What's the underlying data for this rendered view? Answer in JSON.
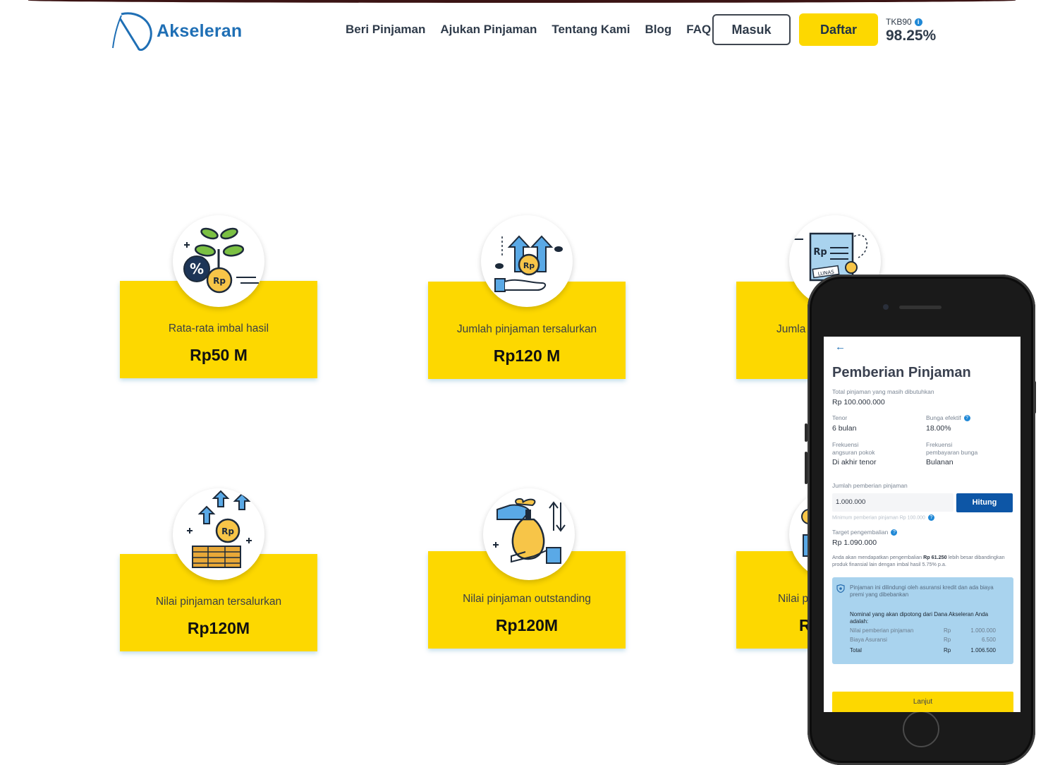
{
  "header": {
    "logo_text": "Akseleran",
    "nav": [
      "Beri Pinjaman",
      "Ajukan Pinjaman",
      "Tentang Kami",
      "Blog",
      "FAQ"
    ],
    "login_label": "Masuk",
    "register_label": "Daftar",
    "tkb_label": "TKB90",
    "tkb_value": "98.25%"
  },
  "stats": [
    {
      "label": "Rata-rata imbal hasil",
      "value": "Rp50 M",
      "icon": "plant-percent-icon"
    },
    {
      "label": "Jumlah pinjaman tersalurkan",
      "value": "Rp120 M",
      "icon": "hand-money-growth-icon"
    },
    {
      "label": "Jumla",
      "value": "",
      "icon": "invoice-lunas-icon"
    },
    {
      "label": "Nilai pinjaman tersalurkan",
      "value": "Rp120M",
      "icon": "coin-stack-growth-icon"
    },
    {
      "label": "Nilai pinjaman outstanding",
      "value": "Rp120M",
      "icon": "money-bag-exchange-icon"
    },
    {
      "label": "Nilai p",
      "value": "R",
      "icon": "partial-icon"
    }
  ],
  "phone": {
    "back_icon": "arrow-left-icon",
    "title": "Pemberian Pinjaman",
    "total_label": "Total pinjaman yang masih dibutuhkan",
    "total_value": "Rp 100.000.000",
    "tenor_label": "Tenor",
    "tenor_value": "6 bulan",
    "bunga_label": "Bunga efektif",
    "bunga_value": "18.00%",
    "freq_pokok_label_1": "Frekuensi",
    "freq_pokok_label_2": "angsuran pokok",
    "freq_pokok_value": "Di akhir tenor",
    "freq_bunga_label_1": "Frekuensi",
    "freq_bunga_label_2": "pembayaran bunga",
    "freq_bunga_value": "Bulanan",
    "jumlah_label": "Jumlah pemberian pinjaman",
    "jumlah_value": "1.000.000",
    "hitung_label": "Hitung",
    "minimum_note": "Minimum pemberian pinjaman Rp 100.000",
    "target_label": "Target pengembalian",
    "target_value": "Rp 1.090.000",
    "note_a": "Anda akan mendapatkan pengembalian ",
    "note_b": "Rp 61.250",
    "note_c": " lebih besar dibandingkan produk finansial lain dengan imbal hasil 5.75% p.a.",
    "insurance_text": "Pinjaman ini dilindungi oleh asuransi kredit dan ada biaya premi yang dibebankan",
    "deduct_text": "Nominal yang akan dipotong dari Dana Akseleran Anda adalah:",
    "rows": [
      {
        "label": "Nilai pemberian pinjaman",
        "rp": "Rp",
        "amount": "1.000.000"
      },
      {
        "label": "Biaya Asuransi",
        "rp": "Rp",
        "amount": "6.500"
      },
      {
        "label": "Total",
        "rp": "Rp",
        "amount": "1.006.500"
      }
    ],
    "lanjut_label": "Lanjut"
  },
  "colors": {
    "accent_yellow": "#fdd800",
    "brand_blue": "#1f6fb5",
    "button_blue": "#0d56a6",
    "info_box": "#a9d3ee"
  }
}
